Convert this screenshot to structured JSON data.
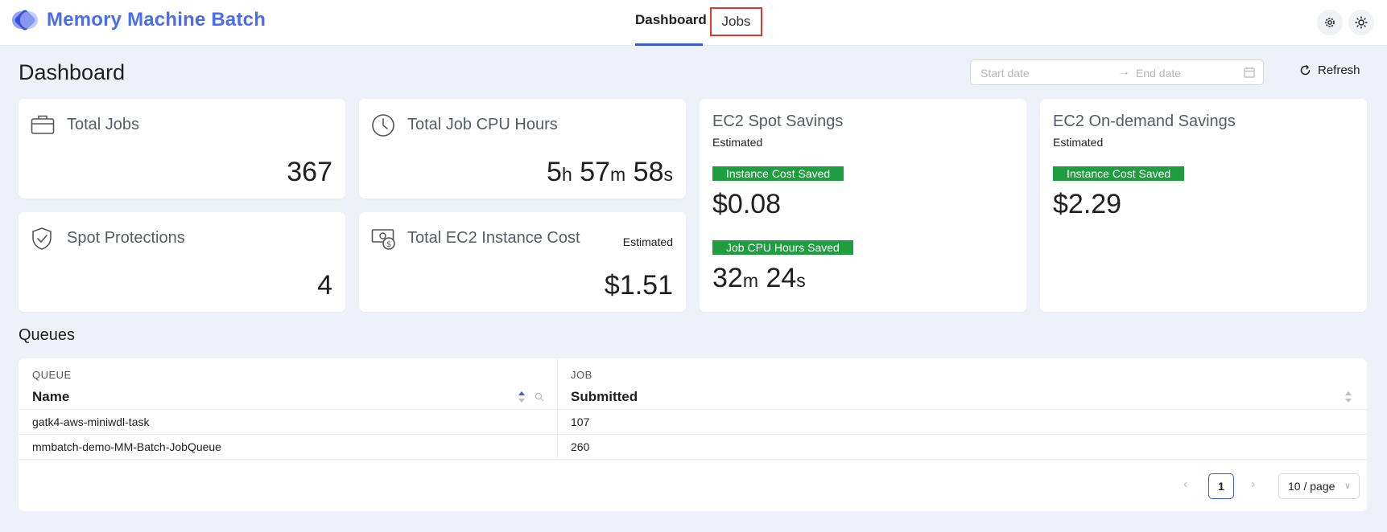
{
  "brand": {
    "title": "Memory Machine Batch"
  },
  "nav": {
    "dashboard": "Dashboard",
    "jobs": "Jobs"
  },
  "page": {
    "title": "Dashboard"
  },
  "date_range": {
    "start_placeholder": "Start date",
    "arrow": "→",
    "end_placeholder": "End date"
  },
  "refresh": {
    "label": "Refresh"
  },
  "cards": {
    "total_jobs": {
      "title": "Total Jobs",
      "value": "367"
    },
    "cpu_hours": {
      "title": "Total Job CPU Hours",
      "h": "5",
      "h_unit": "h",
      "m": "57",
      "m_unit": "m",
      "s": "58",
      "s_unit": "s"
    },
    "spot_protections": {
      "title": "Spot Protections",
      "value": "4"
    },
    "ec2_cost": {
      "title": "Total EC2 Instance Cost",
      "estimated": "Estimated",
      "value": "$1.51"
    },
    "spot_savings": {
      "title": "EC2 Spot Savings",
      "estimated": "Estimated",
      "tag_cost": "Instance Cost Saved",
      "cost_value": "$0.08",
      "tag_cpu": "Job CPU Hours Saved",
      "m": "32",
      "m_unit": "m",
      "s": "24",
      "s_unit": "s"
    },
    "ondemand_savings": {
      "title": "EC2 On-demand Savings",
      "estimated": "Estimated",
      "tag_cost": "Instance Cost Saved",
      "cost_value": "$2.29"
    }
  },
  "queues": {
    "title": "Queues",
    "columns": [
      {
        "group": "QUEUE",
        "name": "Name"
      },
      {
        "group": "JOB",
        "name": "Submitted"
      }
    ],
    "rows": [
      {
        "name": "gatk4-aws-miniwdl-task",
        "submitted": "107"
      },
      {
        "name": "mmbatch-demo-MM-Batch-JobQueue",
        "submitted": "260"
      }
    ],
    "pagination": {
      "prev": "‹",
      "current": "1",
      "next": "›",
      "page_size": "10 / page",
      "chevron": "∨"
    }
  }
}
